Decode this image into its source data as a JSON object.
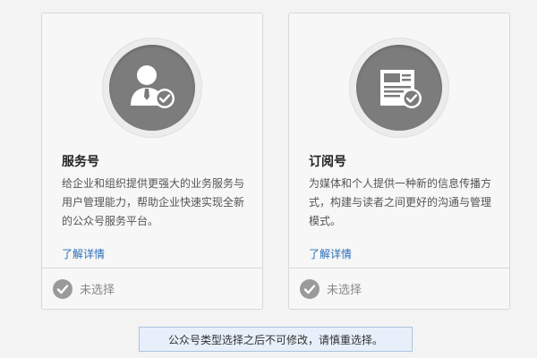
{
  "cards": [
    {
      "title": "服务号",
      "description": "给企业和组织提供更强大的业务服务与用户管理能力，帮助企业快速实现全新的公众号服务平台。",
      "link_label": "了解详情",
      "status": "未选择",
      "icon": "user-check-icon"
    },
    {
      "title": "订阅号",
      "description": "为媒体和个人提供一种新的信息传播方式，构建与读者之间更好的沟通与管理模式。",
      "link_label": "了解详情",
      "status": "未选择",
      "icon": "document-check-icon"
    }
  ],
  "notice": "公众号类型选择之后不可修改，请慎重选择。",
  "colors": {
    "link": "#2a6db8",
    "badge": "#7c7c7c",
    "notice_bg": "#e7f0fa",
    "notice_border": "#a9c4e0"
  }
}
